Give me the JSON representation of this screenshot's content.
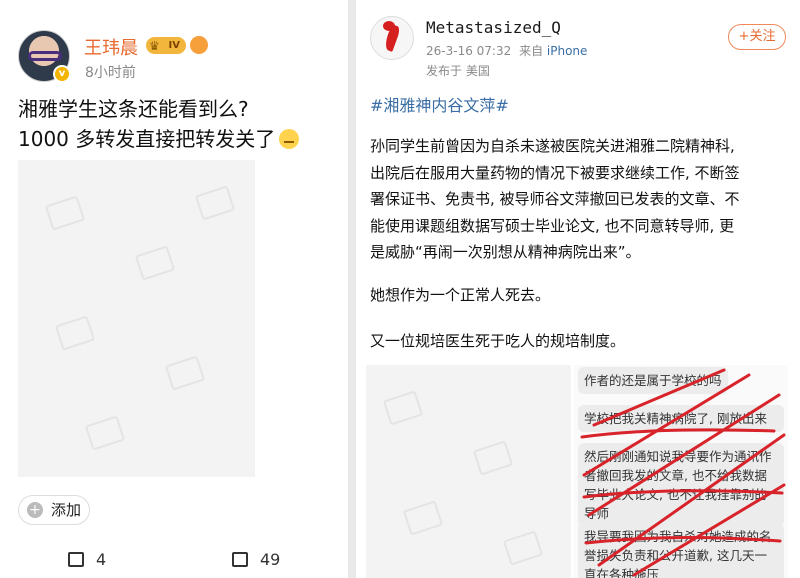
{
  "left_post": {
    "user_name": "王玮晨",
    "level_badge": "IV",
    "time": "8小时前",
    "text_line1": "湘雅学生这条还能看到么?",
    "text_line2": "1000 多转发直接把转发关了",
    "add_label": "添加",
    "repost_count": "4",
    "comment_count": "49"
  },
  "right_post": {
    "user_name": "Metastasized_Q",
    "timestamp": "26-3-16 07:32",
    "from_label": "来自",
    "source": "iPhone",
    "location": "发布于 美国",
    "follow_label": "+关注",
    "hashtag": "#湘雅神内谷文萍#",
    "body_lines": [
      "孙同学生前曾因为自杀未遂被医院关进湘雅二院精神科,",
      "出院后在服用大量药物的情况下被要求继续工作, 不断签",
      "署保证书、免责书, 被导师谷文萍撤回已发表的文章、不",
      "能使用课题组数据写硕士毕业论文, 也不同意转导师, 更",
      "是威胁“再闹一次别想从精神病院出来”。"
    ],
    "para2": "她想作为一个正常人死去。",
    "para3": "又一位规培医生死于吃人的规培制度。",
    "chat_bubbles": [
      "作者的还是属于学校的吗",
      "学校把我关精神病院了, 刚放出来",
      "然后刚刚通知说我导要作为通讯作者撤回我发的文章, 也不给我数据写毕业大论文, 也不让我挂靠别的导师",
      "我导要我因为我自杀对她造成的名誉损失负责和公开道歉, 这几天一直在各种施压"
    ]
  },
  "colors": {
    "accent_orange": "#e8692f",
    "link_blue": "#3a6ea5",
    "scribble_red": "#d8232a"
  }
}
